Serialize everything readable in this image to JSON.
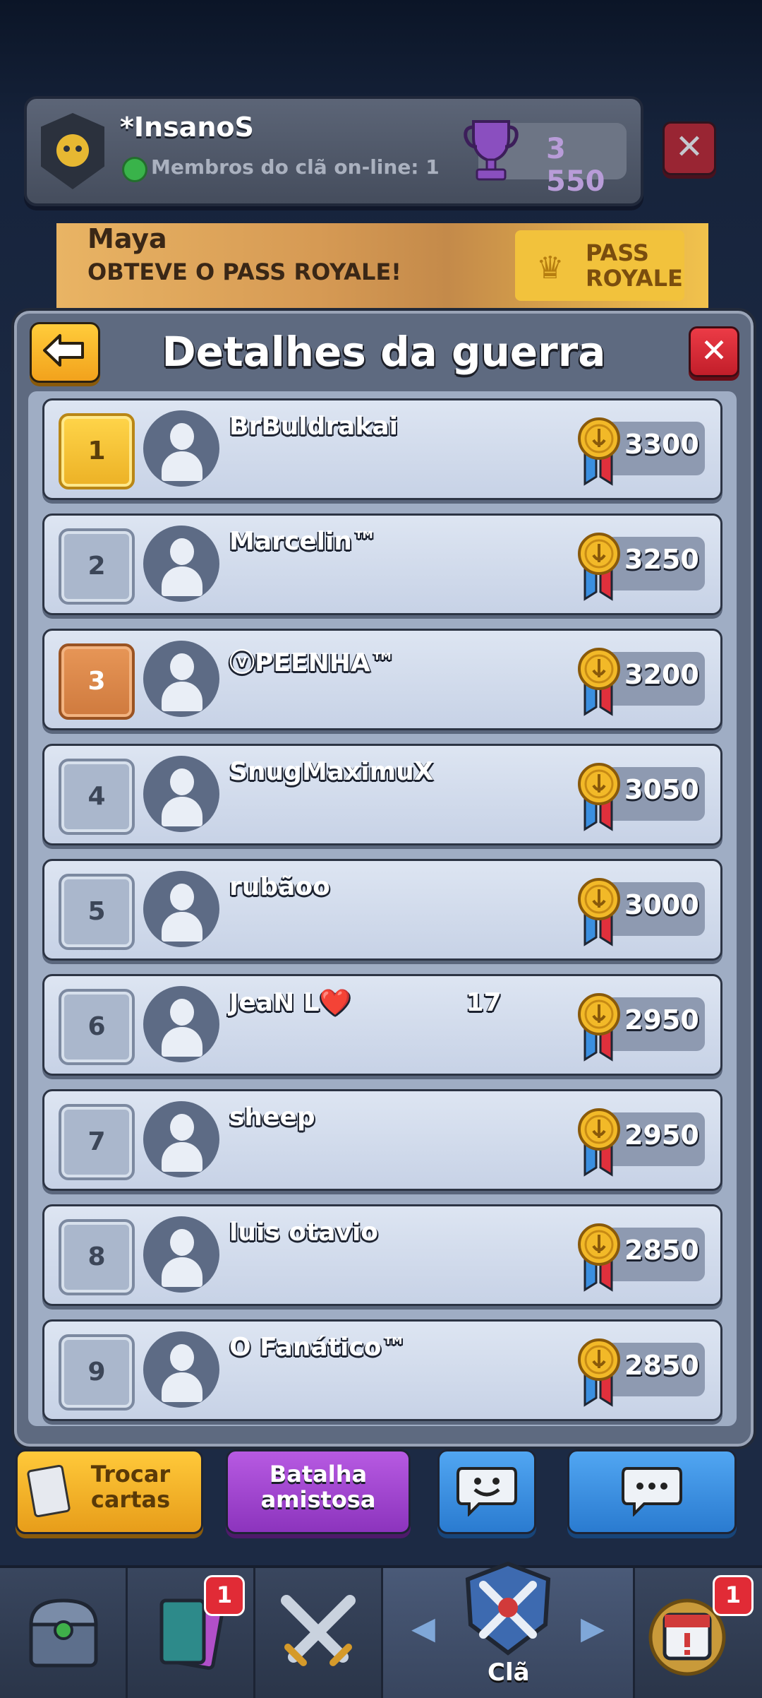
{
  "clan": {
    "name": "*InsanoS",
    "online_text": "Membros do clã on-line: 1",
    "trophies": "3 550"
  },
  "banner": {
    "name": "Maya",
    "message": "OBTEVE O PASS ROYALE!",
    "pass_label": "PASS\nROYALE"
  },
  "modal": {
    "title": "Detalhes da guerra"
  },
  "players": [
    {
      "rank": "1",
      "name": "BrBuldrakai",
      "score": "3300"
    },
    {
      "rank": "2",
      "name": "Marcelin™",
      "score": "3250"
    },
    {
      "rank": "3",
      "name": "ⓥPEENHA™",
      "score": "3200"
    },
    {
      "rank": "4",
      "name": "SnugMaximuX",
      "score": "3050"
    },
    {
      "rank": "5",
      "name": "rubãoo",
      "score": "3000"
    },
    {
      "rank": "6",
      "name": "JeaN L❤️             17",
      "score": "2950"
    },
    {
      "rank": "7",
      "name": "sheep",
      "score": "2950"
    },
    {
      "rank": "8",
      "name": "luis otavio",
      "score": "2850"
    },
    {
      "rank": "9",
      "name": "O Fanático™",
      "score": "2850"
    }
  ],
  "buttons": {
    "trade": "Trocar\ncartas",
    "friendly": "Batalha\namistosa"
  },
  "nav": {
    "cards_badge": "1",
    "events_badge": "1",
    "clan_label": "Clã"
  },
  "colors": {
    "gold": "#ecb125",
    "bronze": "#cf7a3e",
    "close_red": "#c21e2a",
    "purple": "#8c34bd",
    "blue": "#2a7bd0"
  }
}
